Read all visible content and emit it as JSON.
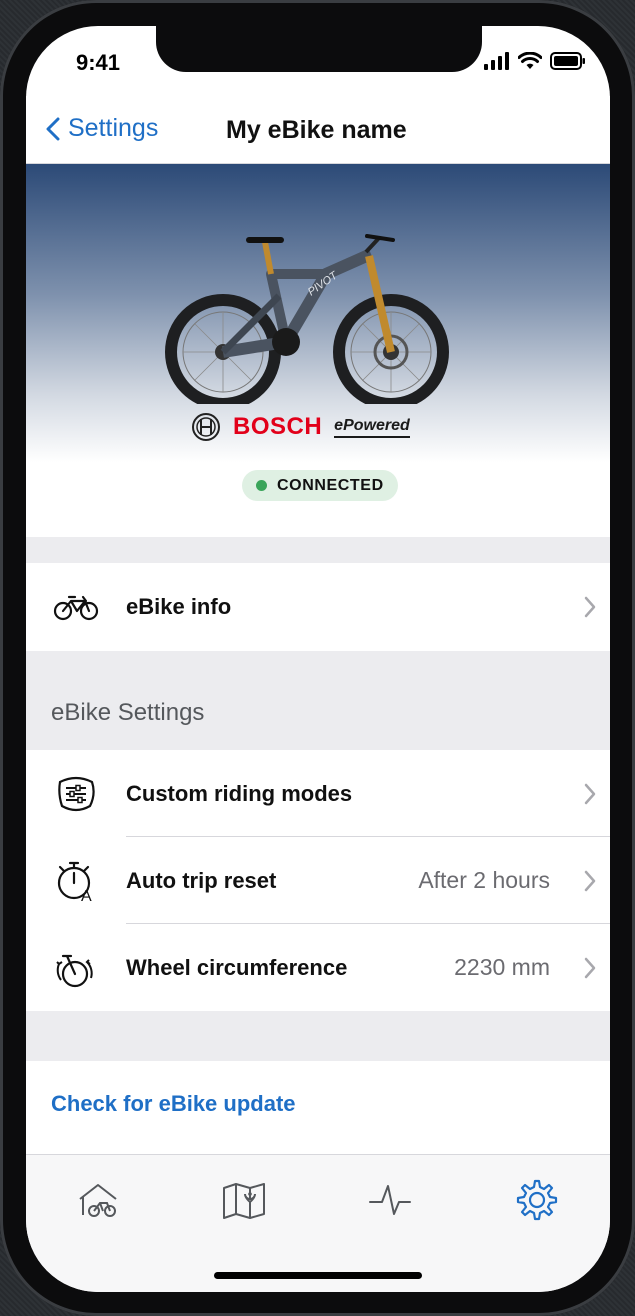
{
  "status_bar": {
    "time": "9:41"
  },
  "nav": {
    "back_label": "Settings",
    "title": "My eBike name"
  },
  "hero": {
    "brand": "BOSCH",
    "powered": "ePowered",
    "status": "CONNECTED",
    "status_color": "#3aa55a"
  },
  "rows": {
    "ebike_info": {
      "label": "eBike info",
      "icon": "bike-icon"
    }
  },
  "section": {
    "title": "eBike Settings",
    "items": [
      {
        "label": "Custom riding modes",
        "value": "",
        "icon": "riding-modes-icon"
      },
      {
        "label": "Auto trip reset",
        "value": "After 2 hours",
        "icon": "timer-icon"
      },
      {
        "label": "Wheel circumference",
        "value": "2230 mm",
        "icon": "wheel-icon"
      }
    ]
  },
  "update": {
    "label": "Check for eBike update"
  },
  "tabs": [
    {
      "name": "home-ebike",
      "icon": "home-bike-icon"
    },
    {
      "name": "map",
      "icon": "map-icon"
    },
    {
      "name": "activity",
      "icon": "activity-icon"
    },
    {
      "name": "settings",
      "icon": "gear-icon",
      "active": true
    }
  ],
  "colors": {
    "accent": "#1f6fc6",
    "brand_red": "#e2001a"
  }
}
